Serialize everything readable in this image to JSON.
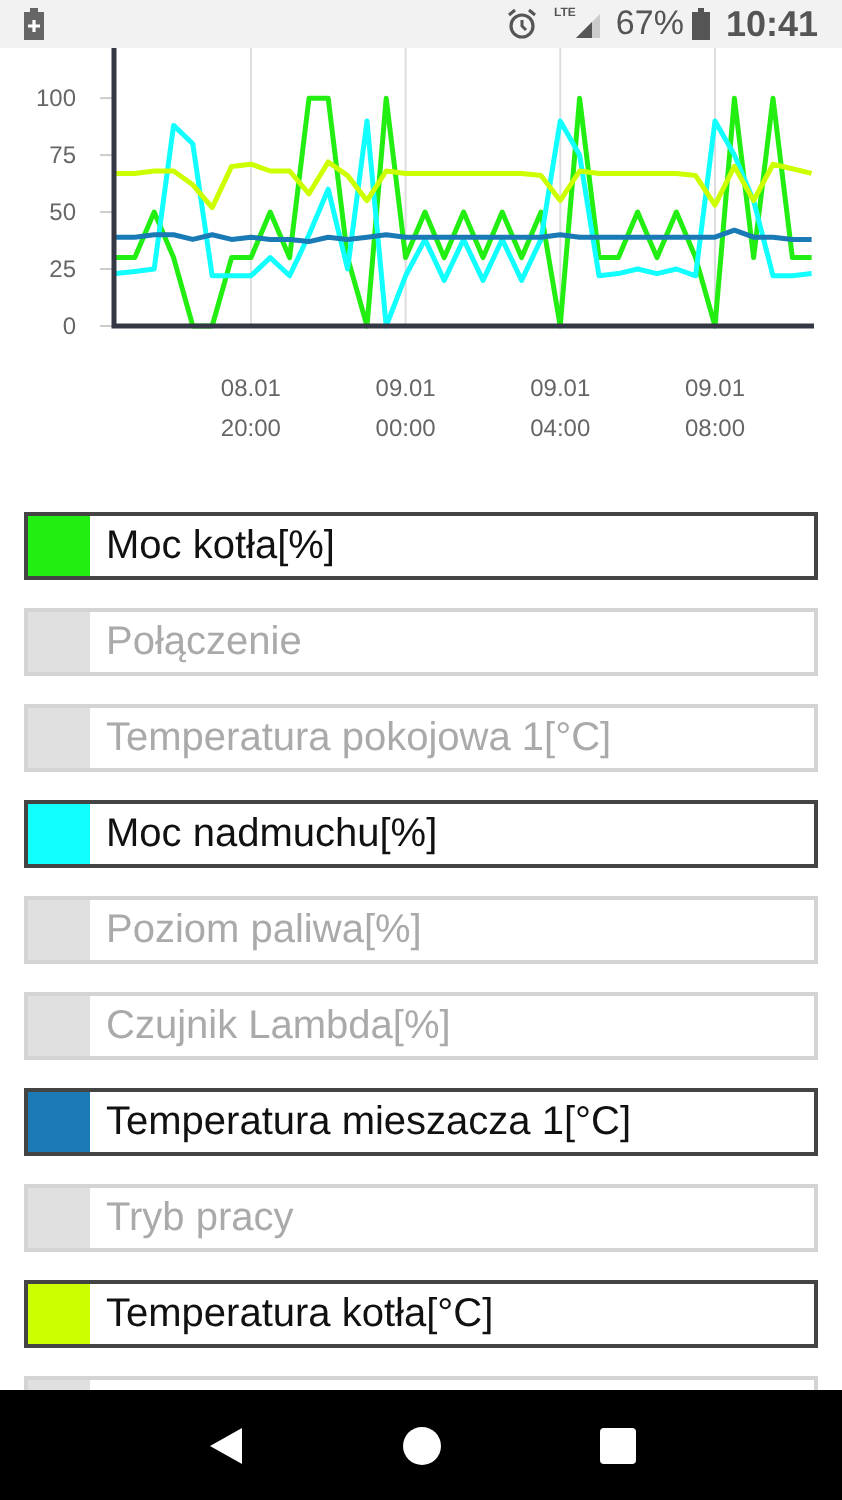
{
  "status_bar": {
    "network": "LTE",
    "battery": "67%",
    "time": "10:41"
  },
  "chart": {
    "chart_data": {
      "type": "line",
      "categories": [
        null,
        null,
        null,
        null,
        null,
        null,
        null,
        "08.01 20:00",
        null,
        null,
        null,
        null,
        null,
        null,
        null,
        "09.01 00:00",
        null,
        null,
        null,
        null,
        null,
        null,
        null,
        "09.01 04:00",
        null,
        null,
        null,
        null,
        null,
        null,
        null,
        "09.01 08:00",
        null,
        null,
        null,
        null,
        null
      ],
      "grid": "x",
      "ylim": [
        0,
        122
      ],
      "yticks": [
        0,
        25,
        50,
        75,
        100
      ],
      "series": [
        {
          "name": "Moc kotła[%]",
          "color": "#22ee11",
          "values": [
            30,
            30,
            50,
            30,
            0,
            0,
            30,
            30,
            50,
            30,
            100,
            100,
            30,
            0,
            100,
            30,
            50,
            30,
            50,
            30,
            50,
            30,
            50,
            0,
            100,
            30,
            30,
            50,
            30,
            50,
            30,
            0,
            100,
            30,
            100,
            30,
            30
          ]
        },
        {
          "name": "Moc nadmuchu[%]",
          "color": "#11ffff",
          "values": [
            23,
            24,
            25,
            88,
            80,
            22,
            22,
            22,
            30,
            22,
            40,
            60,
            25,
            90,
            0,
            22,
            38,
            20,
            38,
            20,
            38,
            20,
            38,
            90,
            75,
            22,
            23,
            25,
            23,
            25,
            22,
            90,
            75,
            55,
            22,
            22,
            23
          ]
        },
        {
          "name": "Temperatura mieszacza 1[°C]",
          "color": "#1a7ab5",
          "values": [
            39,
            39,
            40,
            40,
            38,
            40,
            38,
            39,
            38,
            38,
            37,
            39,
            38,
            39,
            40,
            39,
            39,
            39,
            39,
            39,
            39,
            39,
            39,
            40,
            39,
            39,
            39,
            39,
            39,
            39,
            39,
            39,
            42,
            39,
            39,
            38,
            38
          ]
        },
        {
          "name": "Temperatura kotła[°C]",
          "color": "#ccff00",
          "values": [
            67,
            67,
            68,
            68,
            62,
            52,
            70,
            71,
            68,
            68,
            58,
            72,
            66,
            55,
            68,
            67,
            67,
            67,
            67,
            67,
            67,
            67,
            66,
            55,
            68,
            67,
            67,
            67,
            67,
            67,
            66,
            53,
            70,
            55,
            71,
            69,
            67
          ]
        }
      ]
    }
  },
  "legend": [
    {
      "selected": true
    },
    {
      "label": "Połączenie",
      "selected": false
    },
    {
      "label": "Temperatura pokojowa 1[°C]",
      "selected": false
    },
    {
      "selected": true
    },
    {
      "label": "Poziom paliwa[%]",
      "selected": false
    },
    {
      "label": "Czujnik Lambda[%]",
      "selected": false
    },
    {
      "selected": true
    },
    {
      "label": "Tryb pracy",
      "selected": false
    },
    {
      "selected": true
    }
  ]
}
